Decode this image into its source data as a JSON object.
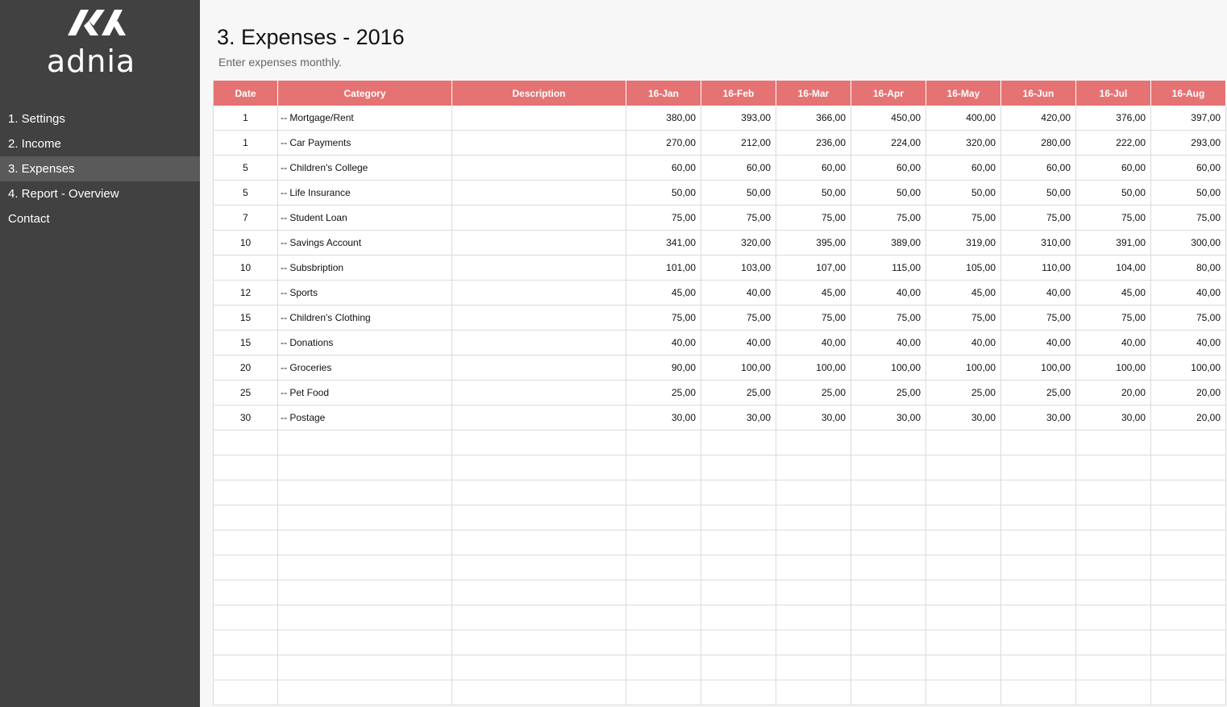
{
  "app": {
    "logo_text": "adnia"
  },
  "nav": {
    "items": [
      {
        "label": "1. Settings",
        "active": false
      },
      {
        "label": "2. Income",
        "active": false
      },
      {
        "label": "3. Expenses",
        "active": true
      },
      {
        "label": "4. Report - Overview",
        "active": false
      },
      {
        "label": "Contact",
        "active": false
      }
    ]
  },
  "page": {
    "title": "3. Expenses - 2016",
    "subtitle": "Enter expenses monthly."
  },
  "table": {
    "headers": [
      "Date",
      "Category",
      "Description",
      "16-Jan",
      "16-Feb",
      "16-Mar",
      "16-Apr",
      "16-May",
      "16-Jun",
      "16-Jul",
      "16-Aug"
    ],
    "rows": [
      {
        "date": "1",
        "category": "-- Mortgage/Rent",
        "description": "",
        "values": [
          "380,00",
          "393,00",
          "366,00",
          "450,00",
          "400,00",
          "420,00",
          "376,00",
          "397,00"
        ]
      },
      {
        "date": "1",
        "category": "-- Car Payments",
        "description": "",
        "values": [
          "270,00",
          "212,00",
          "236,00",
          "224,00",
          "320,00",
          "280,00",
          "222,00",
          "293,00"
        ]
      },
      {
        "date": "5",
        "category": "-- Children's College",
        "description": "",
        "values": [
          "60,00",
          "60,00",
          "60,00",
          "60,00",
          "60,00",
          "60,00",
          "60,00",
          "60,00"
        ]
      },
      {
        "date": "5",
        "category": "-- Life Insurance",
        "description": "",
        "values": [
          "50,00",
          "50,00",
          "50,00",
          "50,00",
          "50,00",
          "50,00",
          "50,00",
          "50,00"
        ]
      },
      {
        "date": "7",
        "category": "-- Student Loan",
        "description": "",
        "values": [
          "75,00",
          "75,00",
          "75,00",
          "75,00",
          "75,00",
          "75,00",
          "75,00",
          "75,00"
        ]
      },
      {
        "date": "10",
        "category": "-- Savings Account",
        "description": "",
        "values": [
          "341,00",
          "320,00",
          "395,00",
          "389,00",
          "319,00",
          "310,00",
          "391,00",
          "300,00"
        ]
      },
      {
        "date": "10",
        "category": "-- Subsbription",
        "description": "",
        "values": [
          "101,00",
          "103,00",
          "107,00",
          "115,00",
          "105,00",
          "110,00",
          "104,00",
          "80,00"
        ]
      },
      {
        "date": "12",
        "category": "-- Sports",
        "description": "",
        "values": [
          "45,00",
          "40,00",
          "45,00",
          "40,00",
          "45,00",
          "40,00",
          "45,00",
          "40,00"
        ]
      },
      {
        "date": "15",
        "category": "-- Children's Clothing",
        "description": "",
        "values": [
          "75,00",
          "75,00",
          "75,00",
          "75,00",
          "75,00",
          "75,00",
          "75,00",
          "75,00"
        ]
      },
      {
        "date": "15",
        "category": "-- Donations",
        "description": "",
        "values": [
          "40,00",
          "40,00",
          "40,00",
          "40,00",
          "40,00",
          "40,00",
          "40,00",
          "40,00"
        ]
      },
      {
        "date": "20",
        "category": "-- Groceries",
        "description": "",
        "values": [
          "90,00",
          "100,00",
          "100,00",
          "100,00",
          "100,00",
          "100,00",
          "100,00",
          "100,00"
        ]
      },
      {
        "date": "25",
        "category": "-- Pet Food",
        "description": "",
        "values": [
          "25,00",
          "25,00",
          "25,00",
          "25,00",
          "25,00",
          "25,00",
          "20,00",
          "20,00"
        ]
      },
      {
        "date": "30",
        "category": "-- Postage",
        "description": "",
        "values": [
          "30,00",
          "30,00",
          "30,00",
          "30,00",
          "30,00",
          "30,00",
          "30,00",
          "20,00"
        ]
      }
    ],
    "empty_rows": 11
  },
  "colors": {
    "header": "#e57373",
    "sidebar": "#414141",
    "sidebar_active": "#5a5a5a"
  }
}
